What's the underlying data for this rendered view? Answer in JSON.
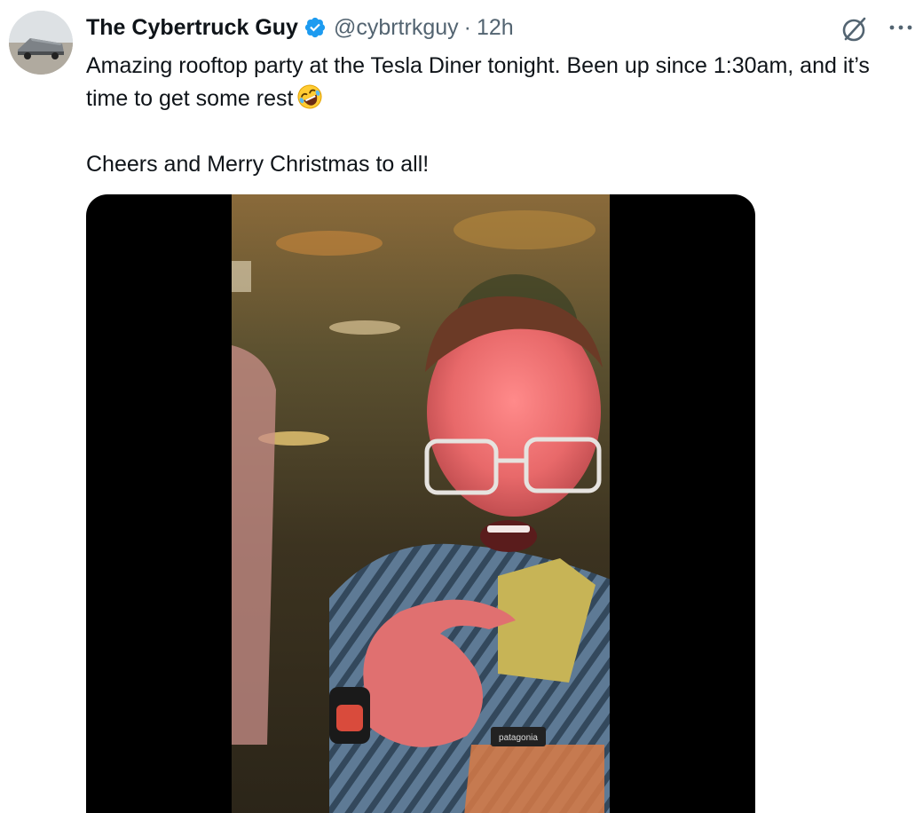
{
  "tweet": {
    "author": {
      "display_name": "The Cybertruck Guy",
      "handle": "@cybrtrkguy",
      "verified": true,
      "avatar_icon": "cybertruck-avatar"
    },
    "separator": "·",
    "timestamp": "12h",
    "text_line_1": "Amazing rooftop party at the Tesla Diner tonight. Been up since 1:30am, and it’s time to get some rest",
    "text_emoji": "rolling-on-floor-laughing-emoji",
    "text_line_2": "Cheers and Merry Christmas to all!",
    "media": {
      "type": "video",
      "jacket_brand": "patagonia"
    },
    "actions": {
      "grok_icon": "grok-icon",
      "more_icon": "more-horizontal-icon"
    }
  },
  "colors": {
    "text_primary": "#0f1419",
    "text_secondary": "#536471",
    "verified_blue": "#1d9bf0",
    "media_background": "#000000"
  }
}
